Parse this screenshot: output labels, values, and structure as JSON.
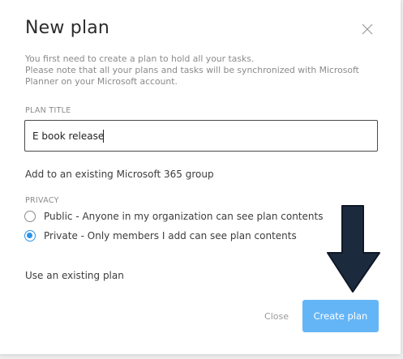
{
  "dialog": {
    "title": "New plan",
    "description_lines": [
      "You first need to create a plan to hold all your tasks.",
      "Please note that all your plans and tasks will be synchronized with Microsoft",
      "Planner on your Microsoft account."
    ]
  },
  "plan_title": {
    "label": "PLAN TITLE",
    "value": "E book release"
  },
  "existing_group_link": "Add to an existing Microsoft 365 group",
  "privacy": {
    "label": "PRIVACY",
    "options": [
      {
        "label": "Public - Anyone in my organization can see plan contents",
        "selected": false
      },
      {
        "label": "Private - Only members I add can see plan contents",
        "selected": true
      }
    ]
  },
  "existing_plan_link": "Use an existing plan",
  "buttons": {
    "close": "Close",
    "create": "Create plan"
  },
  "colors": {
    "accent": "#2b94e8",
    "create_button": "#64b5f6",
    "annotation_arrow": "#1c2a3e"
  },
  "icons": {
    "close": "close-x-icon",
    "annotation": "down-arrow-icon"
  }
}
